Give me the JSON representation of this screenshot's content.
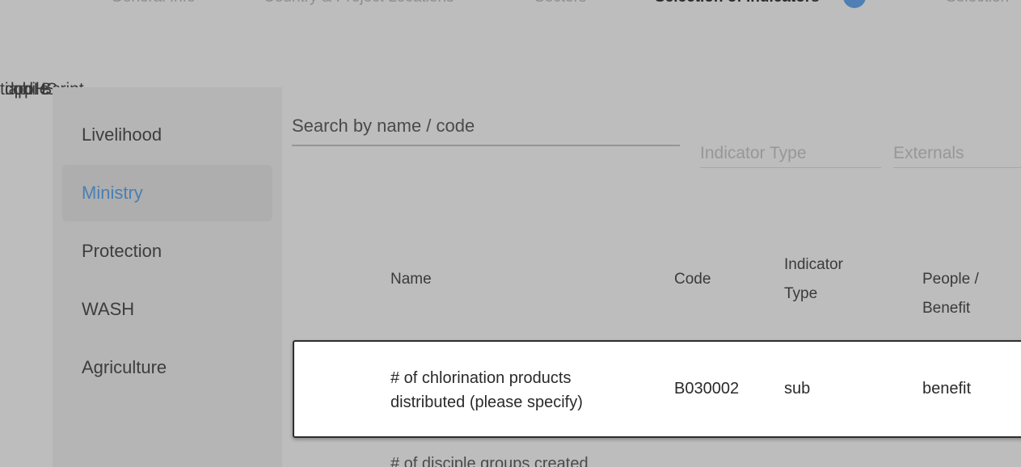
{
  "stepper": {
    "steps": [
      {
        "label": "General Info"
      },
      {
        "label": "Country & Project Locations"
      },
      {
        "label": "Sectors"
      },
      {
        "label": "Selection of Indicators"
      },
      {
        "label": "Selection"
      }
    ]
  },
  "overlap_text": [
    "Script",
    "tiap",
    "dpd",
    "obile",
    "pHS"
  ],
  "sidebar": {
    "items": [
      {
        "label": "Livelihood"
      },
      {
        "label": "Ministry"
      },
      {
        "label": "Protection"
      },
      {
        "label": "WASH"
      },
      {
        "label": "Agriculture"
      }
    ],
    "active": "Ministry"
  },
  "search": {
    "placeholder": "Search by name / code"
  },
  "filters": {
    "indicator_type": "Indicator Type",
    "externals": "Externals"
  },
  "table": {
    "headers": {
      "name": "Name",
      "code": "Code",
      "indicator_type_1": "Indicator",
      "indicator_type_2": "Type",
      "people_1": "People /",
      "people_2": "Benefit"
    },
    "rows": [
      {
        "name_line1": "# of chlorination products",
        "name_line2": "distributed (please specify)",
        "code": "B030002",
        "type": "sub",
        "people": "benefit"
      }
    ],
    "next_row_partial": "# of disciple groups created"
  },
  "colors": {
    "overlay": "#bdbdbd",
    "accent": "#4a7fb3",
    "row_bg": "#ffffff"
  }
}
